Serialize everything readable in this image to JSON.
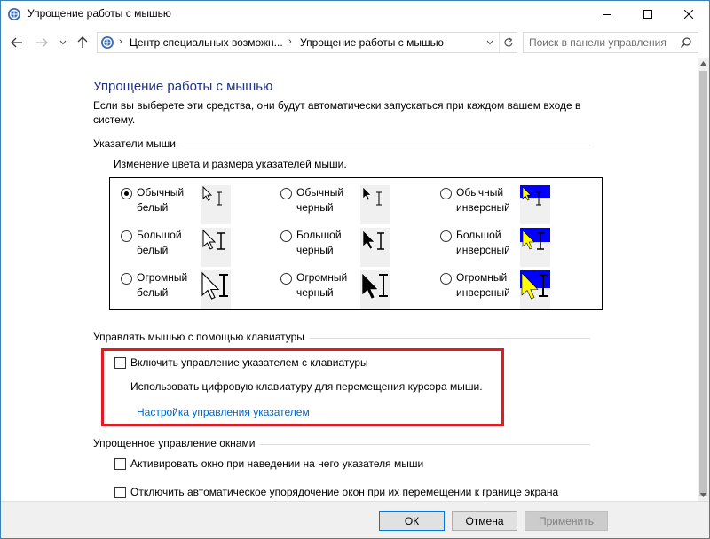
{
  "window": {
    "title": "Упрощение работы с мышью",
    "icon": "ease-of-access-icon"
  },
  "nav": {
    "breadcrumb": [
      "Центр специальных возможн...",
      "Упрощение работы с мышью"
    ],
    "search_placeholder": "Поиск в панели управления"
  },
  "page": {
    "title": "Упрощение работы с мышью",
    "intro": "Если вы выберете эти средства, они будут автоматически запускаться при каждом вашем входе в систему."
  },
  "pointers": {
    "section_title": "Указатели мыши",
    "subtitle": "Изменение цвета и размера указателей мыши.",
    "options": [
      {
        "line1": "Обычный",
        "line2": "белый",
        "selected": true
      },
      {
        "line1": "Обычный",
        "line2": "черный",
        "selected": false
      },
      {
        "line1": "Обычный",
        "line2": "инверсный",
        "selected": false
      },
      {
        "line1": "Большой",
        "line2": "белый",
        "selected": false
      },
      {
        "line1": "Большой",
        "line2": "черный",
        "selected": false
      },
      {
        "line1": "Большой",
        "line2": "инверсный",
        "selected": false
      },
      {
        "line1": "Огромный",
        "line2": "белый",
        "selected": false
      },
      {
        "line1": "Огромный",
        "line2": "черный",
        "selected": false
      },
      {
        "line1": "Огромный",
        "line2": "инверсный",
        "selected": false
      }
    ]
  },
  "keyboard": {
    "section_title": "Управлять мышью с помощью клавиатуры",
    "enable_label": "Включить управление указателем с клавиатуры",
    "enable_checked": false,
    "description": "Использовать цифровую клавиатуру для перемещения курсора мыши.",
    "settings_link": "Настройка управления указателем"
  },
  "windows_mgmt": {
    "section_title": "Упрощенное управление окнами",
    "activate_label": "Активировать окно при наведении на него указателя мыши",
    "activate_checked": false,
    "snap_label": "Отключить автоматическое упорядочение окон при их перемещении к границе экрана",
    "snap_checked": false
  },
  "footer": {
    "ok": "ОК",
    "cancel": "Отмена",
    "apply": "Применить"
  },
  "colors": {
    "title_accent": "#1e3287",
    "link": "#0066cc",
    "highlight_border": "#e01b24",
    "inverse_bg": "#0000ff",
    "inverse_fg": "#ffff00"
  }
}
